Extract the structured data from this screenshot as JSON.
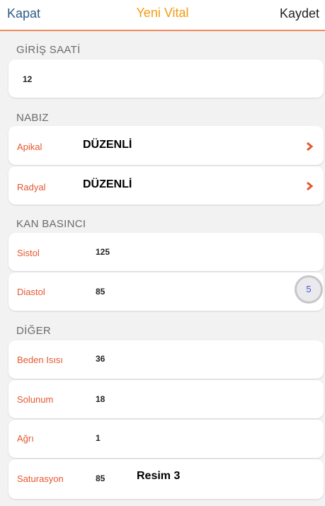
{
  "header": {
    "close_label": "Kapat",
    "title": "Yeni Vital",
    "save_label": "Kaydet"
  },
  "sections": {
    "giris": {
      "title": "GİRİŞ SAATİ",
      "value": "12"
    },
    "nabiz": {
      "title": "NABIZ",
      "apikal": {
        "label": "Apikal",
        "value": "DÜZENLİ"
      },
      "radyal": {
        "label": "Radyal",
        "value": "DÜZENLİ"
      }
    },
    "kan": {
      "title": "KAN BASINCI",
      "sistol": {
        "label": "Sistol",
        "value": "125"
      },
      "diastol": {
        "label": "Diastol",
        "value": "85"
      },
      "badge": "5"
    },
    "diger": {
      "title": "DİĞER",
      "beden": {
        "label": "Beden Isısı",
        "value": "36"
      },
      "solunum": {
        "label": "Solunum",
        "value": "18"
      },
      "agri": {
        "label": "Ağrı",
        "value": "1"
      },
      "saturasyon": {
        "label": "Saturasyon",
        "value": "85",
        "note": "Resim 3"
      }
    }
  },
  "colors": {
    "accent": "#e4572e",
    "title": "#f39c12",
    "link": "#2f5b8a"
  },
  "icons": {
    "row_arrow": "chevron-right-icon"
  }
}
